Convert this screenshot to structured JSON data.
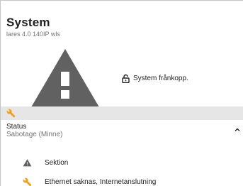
{
  "card": {
    "title": "System",
    "subtitle": "lares 4.0 140IP wls",
    "status_text": "System frånkopp."
  },
  "section": {
    "title": "Status",
    "subtitle": "Sabotage (Minne)"
  },
  "items": [
    {
      "icon": "warning-triangle-icon",
      "label": "Sektion"
    },
    {
      "icon": "wrench-icon",
      "label": "Ethernet saknas, Internetanslutning"
    }
  ],
  "colors": {
    "warning_gray": "#616161",
    "wrench_orange": "#f0a020",
    "toolbar_bg": "#e6e6e6",
    "text": "#212121",
    "muted": "#757575"
  }
}
